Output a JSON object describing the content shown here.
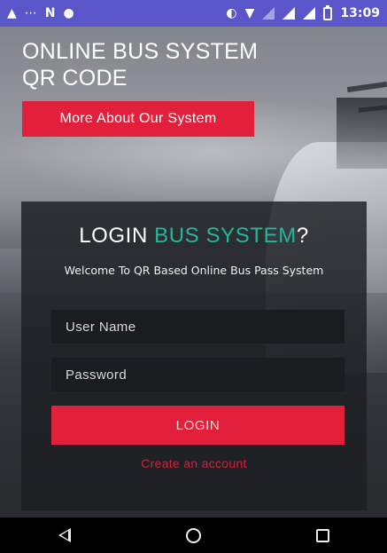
{
  "status_bar": {
    "time": "13:09",
    "icons": [
      "notification-icon",
      "data-usage-icon",
      "n-icon",
      "chat-icon",
      "vibrate-icon",
      "wifi-icon",
      "signal-icon",
      "signal-icon",
      "battery-icon"
    ]
  },
  "header": {
    "title_line1": "ONLINE BUS SYSTEM",
    "title_line2": "QR CODE",
    "more_button_label": "More About Our System"
  },
  "login": {
    "title_prefix": "LOGIN ",
    "title_accent": "BUS SYSTEM",
    "title_suffix": "?",
    "subtitle": "Welcome To QR Based Online Bus Pass System",
    "username_placeholder": "User Name",
    "password_placeholder": "Password",
    "login_button_label": "LOGIN",
    "create_account_label": "Create an account"
  },
  "colors": {
    "status_bar": "#5a56c9",
    "accent_red": "#e3203c",
    "accent_teal": "#23b89a"
  },
  "nav_bar": {
    "icons": [
      "back-icon",
      "home-icon",
      "recent-apps-icon"
    ]
  }
}
